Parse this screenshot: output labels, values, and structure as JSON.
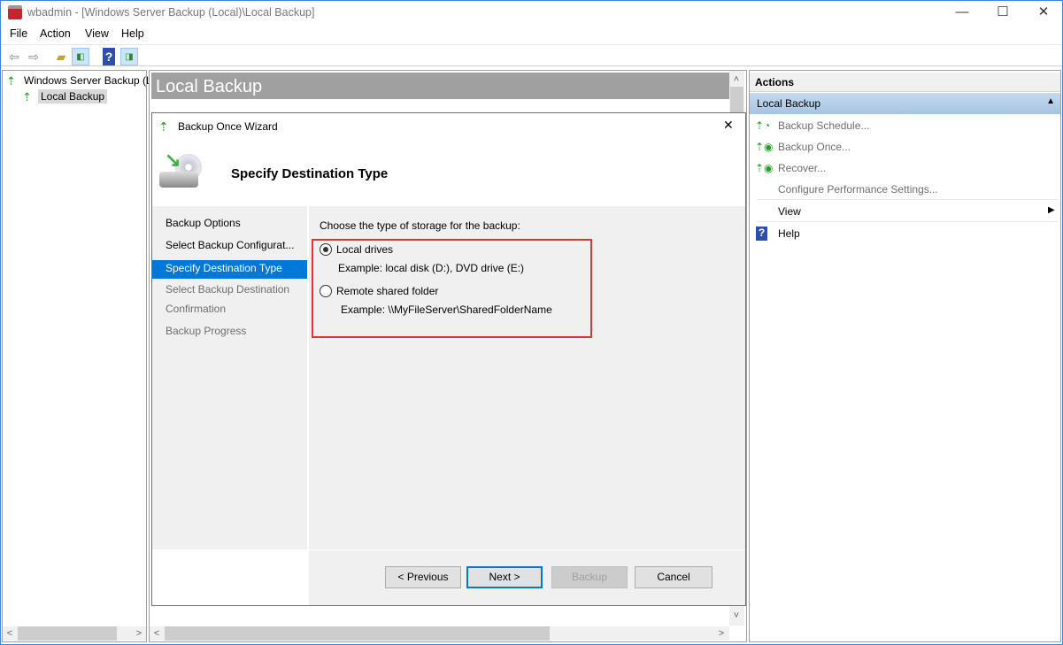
{
  "window": {
    "title": "wbadmin - [Windows Server Backup (Local)\\Local Backup]",
    "minimize": "—",
    "maximize": "☐",
    "close": "✕"
  },
  "menu": [
    "File",
    "Action",
    "View",
    "Help"
  ],
  "tree": {
    "root": "Windows Server Backup (L",
    "child": "Local Backup"
  },
  "center": {
    "header": "Local Backup"
  },
  "wizard": {
    "title": "Backup Once Wizard",
    "close": "✕",
    "heading": "Specify Destination Type",
    "steps": [
      "Backup Options",
      "Select Backup Configurat...",
      "Specify Destination Type",
      "Select Backup Destination",
      "Confirmation",
      "Backup Progress"
    ],
    "active_step": 2,
    "prompt": "Choose the type of storage for the backup:",
    "options": [
      {
        "label": "Local drives",
        "example": "Example: local disk (D:), DVD drive (E:)",
        "selected": true
      },
      {
        "label": "Remote shared folder",
        "example": "Example: \\\\MyFileServer\\SharedFolderName",
        "selected": false
      }
    ],
    "buttons": {
      "previous": "< Previous",
      "next": "Next >",
      "backup": "Backup",
      "cancel": "Cancel"
    }
  },
  "actions": {
    "title": "Actions",
    "section": "Local Backup",
    "items": [
      "Backup Schedule...",
      "Backup Once...",
      "Recover...",
      "Configure Performance Settings..."
    ],
    "view": "View",
    "help": "Help"
  },
  "colors": {
    "accent": "#0078d7",
    "highlight": "#e81123"
  }
}
